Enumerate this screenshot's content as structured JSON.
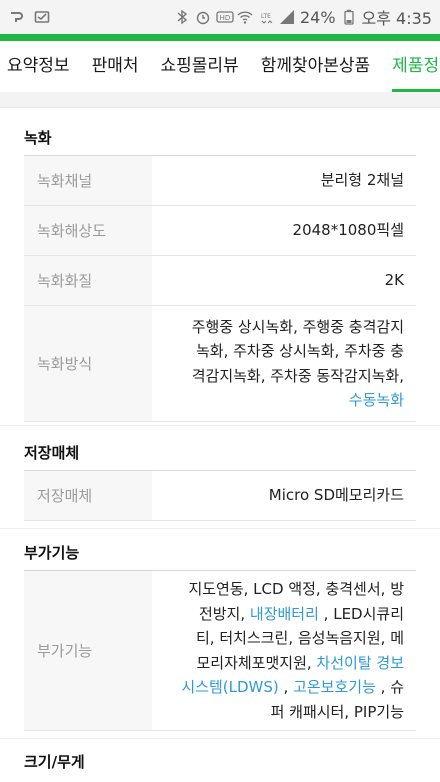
{
  "status_bar": {
    "battery": "24%",
    "time": "오후 4:35",
    "icons": [
      "cloud-icon",
      "inbox-icon",
      "bluetooth-icon",
      "alarm-icon",
      "hd-icon",
      "wifi-icon",
      "lte-icon",
      "signal-icon",
      "battery-icon"
    ]
  },
  "colors": {
    "brand_green": "#1fb847",
    "link_blue": "#2e9ad8",
    "label_gray": "#9b9b9b",
    "label_bg": "#f7f7f7"
  },
  "tabs": [
    {
      "label": "요약정보"
    },
    {
      "label": "판매처"
    },
    {
      "label": "쇼핑몰리뷰"
    },
    {
      "label": "함께찾아본상품"
    },
    {
      "label": "제품정"
    }
  ],
  "active_tab": "제품정",
  "sections": [
    {
      "title": "녹화",
      "rows": [
        {
          "label": "녹화채널",
          "value": "분리형 2채널"
        },
        {
          "label": "녹화해상도",
          "value": "2048*1080픽셀"
        },
        {
          "label": "녹화화질",
          "value": "2K"
        },
        {
          "label": "녹화방식",
          "lines": [
            "주행중 상시녹화, 주행중 충격감지",
            "녹화, 주차중 상시녹화, 주차중 충",
            "격감지녹화, 주차중 동작감지녹화,"
          ],
          "link": "수동녹화"
        }
      ]
    },
    {
      "title": "저장매체",
      "rows": [
        {
          "label": "저장매체",
          "value": "Micro SD메모리카드"
        }
      ]
    },
    {
      "title": "부가기능",
      "rows": [
        {
          "label": "부가기능",
          "l1": "지도연동, LCD 액정, 충격센서, 방",
          "l2a": "전방지, ",
          "l2link": "내장배터리",
          "l2b": " , LED시큐리",
          "l3": "티, 터치스크린, 음성녹음지원, 메",
          "l4a": "모리자체포맷지원, ",
          "l4link": "차선이탈 경보",
          "l5link1": "시스템(LDWS)",
          "l5b": " , ",
          "l5link2": "고온보호기능",
          "l5c": " , 슈",
          "l6": "퍼 캐패시터, PIP기능"
        }
      ]
    },
    {
      "title": "크기/무게"
    }
  ]
}
